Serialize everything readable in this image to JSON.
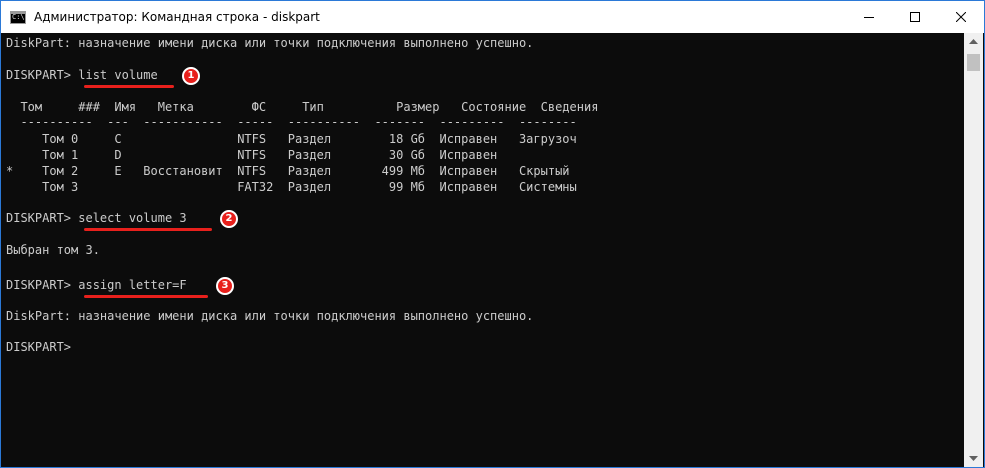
{
  "window": {
    "title": "Администратор: Командная строка - diskpart",
    "app_icon_text": "C:\\",
    "accent_border": "#2b79d7"
  },
  "controls": {
    "minimize": "minimize-icon",
    "maximize": "maximize-icon",
    "close": "close-icon"
  },
  "terminal": {
    "background": "#0c0c0c",
    "foreground": "#cccccc",
    "lines": [
      "DiskPart: назначение имени диска или точки подключения выполнено успешно.",
      "",
      "DISKPART> ",
      "",
      "  Том     ###  Имя   Метка        ФС     Тип          Размер   Состояние  Сведения",
      "  ----------  ---  -----------  -----  ----------  -------  ---------  --------",
      "     Том 0     C                NTFS   Раздел        18 Gб  Исправен   Загрузоч",
      "     Том 1     D                NTFS   Раздел        30 Gб  Исправен",
      "*    Том 2     E   Восстановит  NTFS   Раздел       499 Мб  Исправен   Скрытый",
      "     Том 3                      FAT32  Раздел        99 Мб  Исправен   Системны",
      "",
      "DISKPART> ",
      "",
      "Выбран том 3.",
      "",
      "DISKPART> ",
      "",
      "DiskPart: назначение имени диска или точки подключения выполнено успешно.",
      "",
      "DISKPART>"
    ],
    "commands": {
      "cmd1": "list volume",
      "cmd2": "select volume 3",
      "cmd3": "assign letter=F"
    }
  },
  "annotations": {
    "color": "#e8201c",
    "markers": [
      "1",
      "2",
      "3"
    ]
  },
  "scrollbar": {
    "up": "scroll-up-arrow-icon",
    "down": "scroll-down-arrow-icon"
  }
}
